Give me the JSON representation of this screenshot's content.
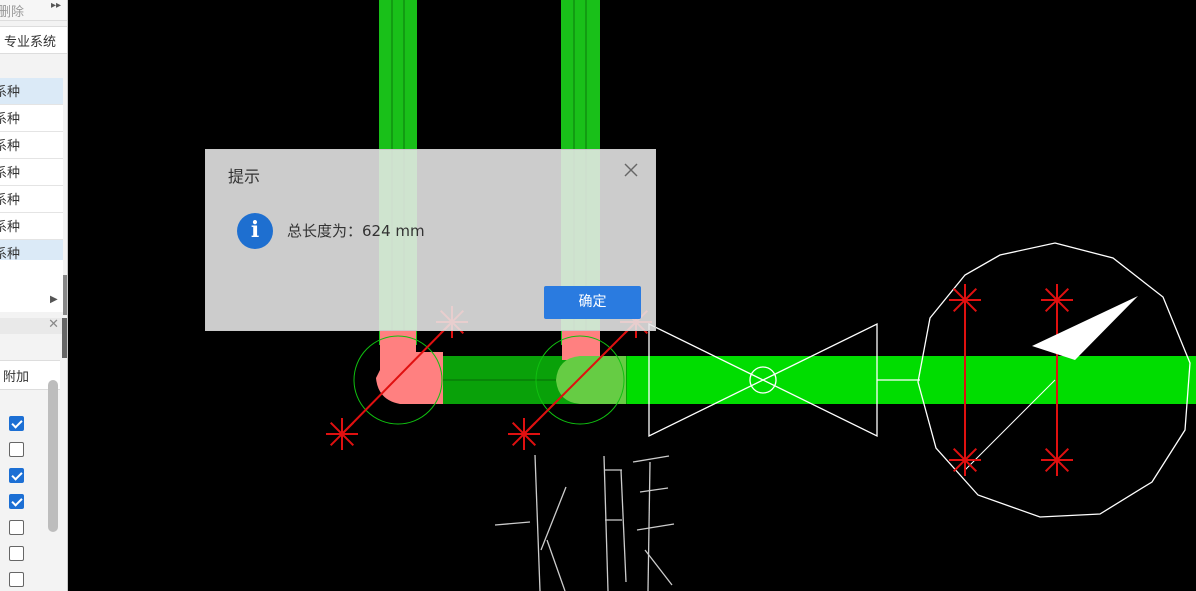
{
  "left_panel": {
    "toolbar": {
      "delete_label": "删除",
      "more_label": "▸▸"
    },
    "header": {
      "col_label": "专业系统"
    },
    "rows": [
      {
        "label": "系种",
        "selected": true
      },
      {
        "label": "系种",
        "selected": false
      },
      {
        "label": "系种",
        "selected": false
      },
      {
        "label": "系种",
        "selected": false
      },
      {
        "label": "系种",
        "selected": false
      },
      {
        "label": "系种",
        "selected": false
      },
      {
        "label": "系种",
        "selected": true
      }
    ],
    "sub_panel": {
      "close_label": "✕",
      "header_label": "附加",
      "checkboxes": [
        true,
        false,
        true,
        true,
        false,
        false,
        false
      ]
    }
  },
  "canvas": {
    "pipe_color": "#00dd00",
    "riser_color": "#19c019",
    "fitting_color": "#ff8080",
    "marker_color": "#e01010",
    "outline_color": "#ffffff",
    "annotation_text": "水暖"
  },
  "dialog": {
    "title": "提示",
    "message": "总长度为：624 mm",
    "ok_label": "确定",
    "icon": "info-icon",
    "accent_color": "#2a7be0"
  }
}
